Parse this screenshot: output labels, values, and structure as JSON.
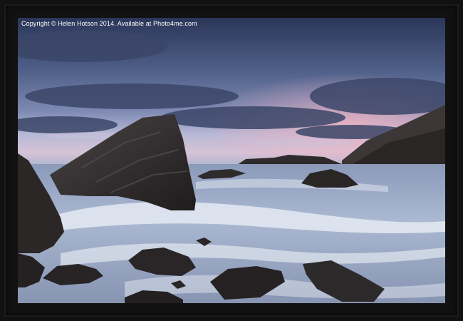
{
  "photo": {
    "copyright_text": "Copyright © Helen Hotson 2014. Available at Photo4me.com"
  },
  "colors": {
    "frame": "#111111",
    "sky_top": "#2c3a5e",
    "sky_mid": "#6f7ea8",
    "sky_glow": "#d9a0b8",
    "horizon_light": "#e8d8e0",
    "sea": "#9fb0cc",
    "surf": "#e8eef6",
    "rock": "#2a2626"
  }
}
